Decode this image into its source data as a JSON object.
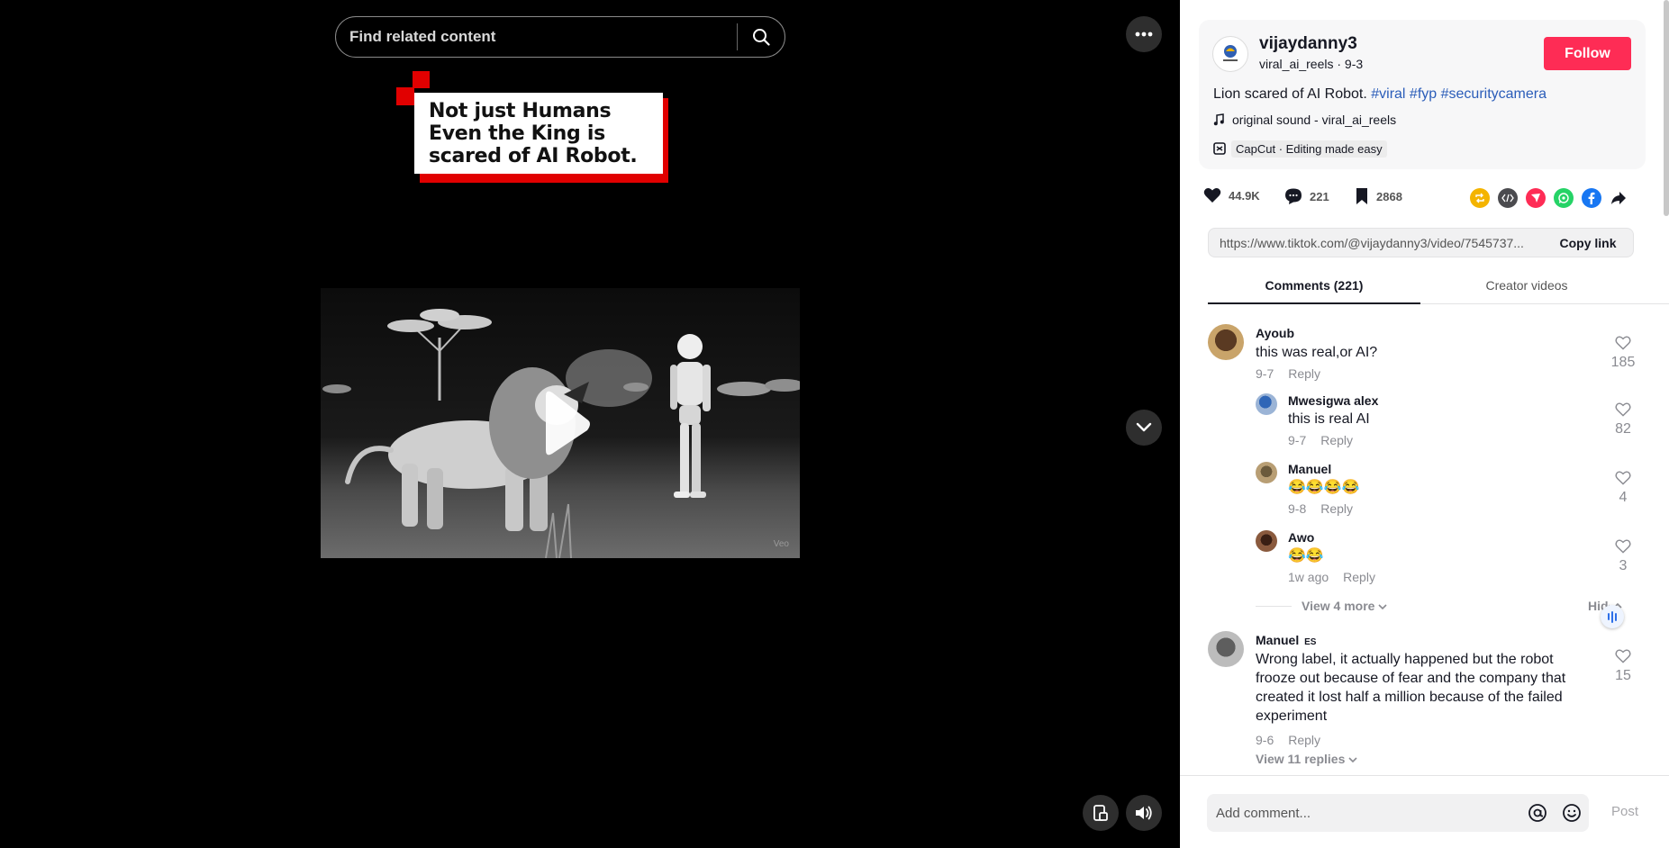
{
  "search": {
    "placeholder": "Find related content"
  },
  "video": {
    "overlay_lines": [
      "Not just Humans",
      "Even the King is",
      "scared of AI Robot."
    ],
    "watermark": "Veo"
  },
  "post": {
    "username": "vijaydanny3",
    "meta": "viral_ai_reels · 9-3",
    "follow_label": "Follow",
    "description": "Lion scared of AI Robot.",
    "hashtags": [
      "#viral",
      "#fyp",
      "#securitycamera"
    ],
    "sound": "original sound - viral_ai_reels",
    "capcut": "CapCut · Editing made easy"
  },
  "actions": {
    "likes": "44.9K",
    "comments": "221",
    "saves": "2868"
  },
  "share_colors": {
    "repost": "#f4b400",
    "embed": "#4b4b4f",
    "direct": "#fe2c55",
    "whatsapp": "#25d366",
    "facebook": "#1877f2"
  },
  "link": {
    "url": "https://www.tiktok.com/@vijaydanny3/video/7545737...",
    "copy_label": "Copy link"
  },
  "tabs": {
    "comments": "Comments (221)",
    "creator": "Creator videos"
  },
  "comments": [
    {
      "name": "Ayoub",
      "text": "this was real,or AI?",
      "date": "9-7",
      "reply": "Reply",
      "likes": "185"
    },
    {
      "name": "Mwesigwa alex",
      "text": "this is real AI",
      "date": "9-7",
      "reply": "Reply",
      "likes": "82"
    },
    {
      "name": "Manuel",
      "text": "😂😂😂😂",
      "date": "9-8",
      "reply": "Reply",
      "likes": "4"
    },
    {
      "name": "Awo",
      "text": "😂😂",
      "date": "1w ago",
      "reply": "Reply",
      "likes": "3"
    },
    {
      "name": "Manuel",
      "badge": "ES",
      "text": "Wrong label, it actually happened but the robot frooze out because of fear and the company that created it lost half a million because of the failed experiment",
      "date": "9-6",
      "reply": "Reply",
      "likes": "15"
    }
  ],
  "view_more": "View 4 more",
  "hide": "Hide",
  "view_replies": "View 11 replies",
  "composer": {
    "placeholder": "Add comment...",
    "post_label": "Post"
  }
}
